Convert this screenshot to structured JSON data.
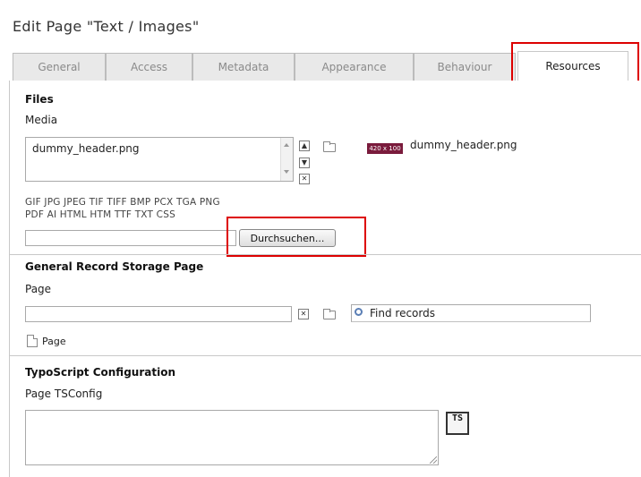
{
  "title": "Edit Page \"Text / Images\"",
  "tabs": [
    {
      "label": "General"
    },
    {
      "label": "Access"
    },
    {
      "label": "Metadata"
    },
    {
      "label": "Appearance"
    },
    {
      "label": "Behaviour"
    },
    {
      "label": "Resources",
      "active": true
    }
  ],
  "files": {
    "section_title": "Files",
    "media_label": "Media",
    "media_value": "dummy_header.png",
    "badge": "420 x 100",
    "preview_filename": "dummy_header.png",
    "allowed_formats_line1": "GIF JPG JPEG TIF TIFF BMP PCX TGA PNG",
    "allowed_formats_line2": "PDF AI HTML HTM TTF TXT CSS",
    "browse_button": "Durchsuchen..."
  },
  "storage": {
    "section_title": "General Record Storage Page",
    "page_label": "Page",
    "find_placeholder": "Find records",
    "page_item": "Page"
  },
  "typoscript": {
    "section_title": "TypoScript Configuration",
    "tsconfig_label": "Page TSConfig",
    "ts_icon_label": "TS"
  },
  "colors": {
    "highlight": "#dd0000",
    "badge": "#7a1b3c"
  }
}
